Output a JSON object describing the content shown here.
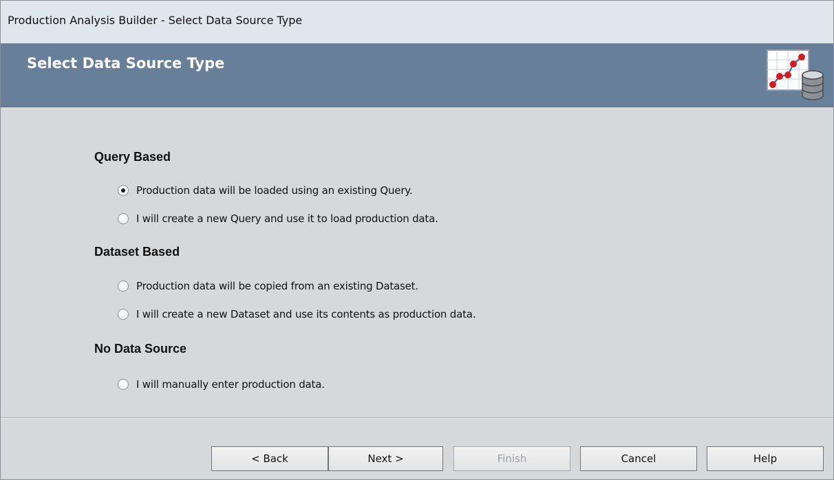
{
  "window": {
    "title": "Production Analysis Builder - Select Data Source Type"
  },
  "header": {
    "title": "Select Data Source Type",
    "icon": "chart-database-icon"
  },
  "sections": [
    {
      "heading": "Query Based",
      "options": [
        {
          "label": "Production data will be loaded using an existing Query.",
          "selected": true
        },
        {
          "label": "I will create a new Query and use it to load production data.",
          "selected": false
        }
      ]
    },
    {
      "heading": "Dataset Based",
      "options": [
        {
          "label": "Production data will be copied from an existing Dataset.",
          "selected": false
        },
        {
          "label": "I will create a new Dataset and use its contents as production data.",
          "selected": false
        }
      ]
    },
    {
      "heading": "No Data Source",
      "options": [
        {
          "label": "I will manually enter production data.",
          "selected": false
        }
      ]
    }
  ],
  "buttons": {
    "back": {
      "label": "< Back",
      "enabled": true
    },
    "next": {
      "label": "Next >",
      "enabled": true
    },
    "finish": {
      "label": "Finish",
      "enabled": false
    },
    "cancel": {
      "label": "Cancel",
      "enabled": true
    },
    "help": {
      "label": "Help",
      "enabled": true
    }
  },
  "colors": {
    "header_background": "#687f99",
    "content_background": "#d6d9dc",
    "titlebar_background": "#dfe6ee"
  }
}
